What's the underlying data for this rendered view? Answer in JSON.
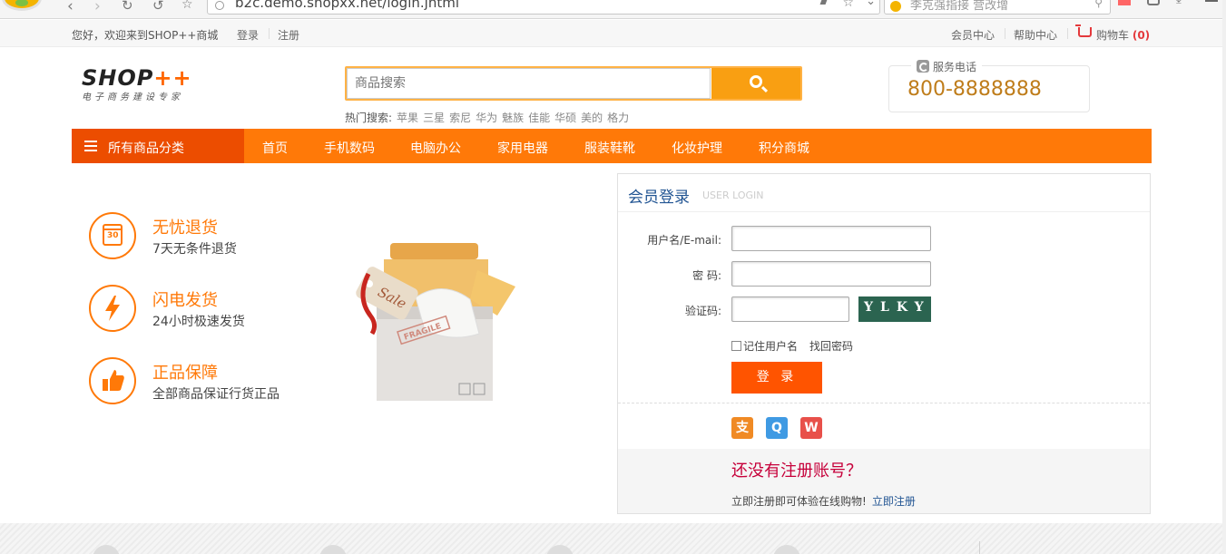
{
  "browser": {
    "url": "b2c.demo.shopxx.net/login.jhtml",
    "search_placeholder": "李克强指接 营改增",
    "nav_icons": [
      "back-icon",
      "forward-icon",
      "reload-icon",
      "undo-icon",
      "bookmark-star-icon"
    ]
  },
  "topbar": {
    "welcome": "您好，欢迎来到SHOP++商城",
    "login": "登录",
    "register": "注册",
    "member_center": "会员中心",
    "help_center": "帮助中心",
    "cart_label": "购物车",
    "cart_count": "(0)"
  },
  "header": {
    "logo_main": "SHOP",
    "logo_plus": "++",
    "logo_sub": "电子商务建设专家",
    "search_placeholder": "商品搜索",
    "hot_label": "热门搜索:",
    "hot_keywords": [
      "苹果",
      "三星",
      "索尼",
      "华为",
      "魅族",
      "佳能",
      "华硕",
      "美的",
      "格力"
    ],
    "service_label": "服务电话",
    "service_phone": "800-8888888"
  },
  "nav": {
    "all_categories": "所有商品分类",
    "items": [
      "首页",
      "手机数码",
      "电脑办公",
      "家用电器",
      "服装鞋靴",
      "化妆护理",
      "积分商城"
    ]
  },
  "features": [
    {
      "title": "无忧退货",
      "desc": "7天无条件退货",
      "icon_text": "30"
    },
    {
      "title": "闪电发货",
      "desc": "24小时极速发货"
    },
    {
      "title": "正品保障",
      "desc": "全部商品保证行货正品"
    }
  ],
  "illustration": {
    "tag_text": "Sale",
    "stamp_text": "FRAGILE"
  },
  "login": {
    "title": "会员登录",
    "subtitle": "USER LOGIN",
    "username_label": "用户名/E-mail:",
    "password_label": "密 码:",
    "captcha_label": "验证码:",
    "captcha_text": "YLKY",
    "remember_label": "记住用户名",
    "forgot_label": "找回密码",
    "submit_label": "登 录",
    "social": [
      "alipay-icon",
      "qq-icon",
      "weibo-icon"
    ],
    "no_account": "还没有注册账号？",
    "register_prompt": "立即注册即可体验在线购物!",
    "register_link": "立即注册"
  },
  "colors": {
    "accent": "#ff7908",
    "accent_dark": "#ec4d00",
    "login_button": "#ff5400",
    "title_blue": "#225593",
    "phone": "#bf7d1b",
    "register_red": "#c6003a"
  }
}
